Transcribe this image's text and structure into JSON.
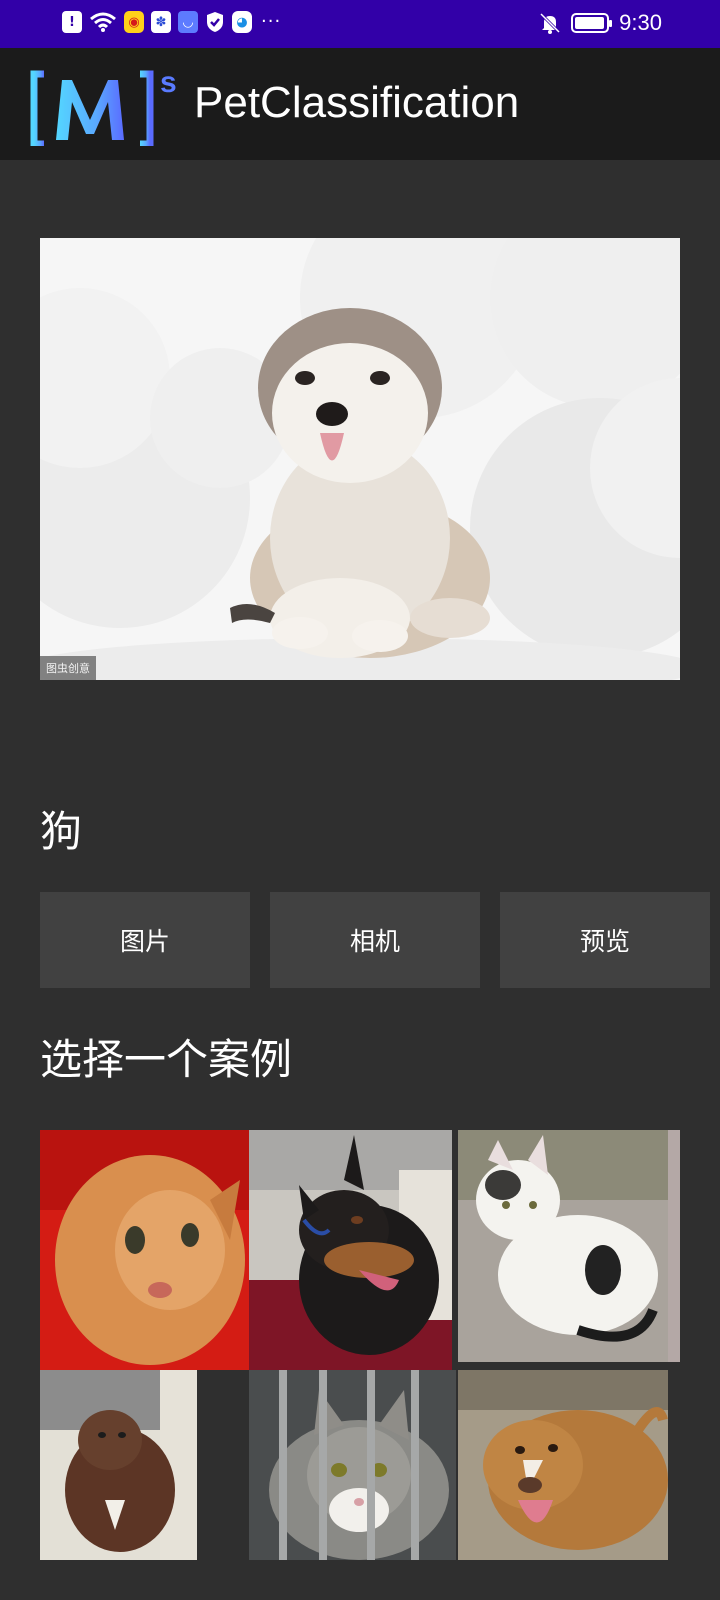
{
  "status_bar": {
    "time": "9:30",
    "more": "···",
    "left_icons": [
      "alert-icon",
      "wifi-icon",
      "weibo-icon",
      "baidu-icon",
      "app-icon",
      "shield-icon",
      "browser-icon"
    ],
    "right_icons": [
      "bell-off-icon",
      "battery-icon"
    ],
    "battery_level": 0.95
  },
  "app_bar": {
    "title": "PetClassification",
    "logo_text": "[M]s"
  },
  "hero": {
    "watermark": "图虫创意"
  },
  "result": {
    "label": "狗"
  },
  "buttons": {
    "image_label": "图片",
    "camera_label": "相机",
    "preview_label": "预览"
  },
  "examples": {
    "title": "选择一个案例",
    "items": [
      "orange-cat",
      "doberman-dog",
      "white-kitten",
      "brown-dog",
      "tabby-cat",
      "pitbull-dog"
    ]
  },
  "colors": {
    "status_bar": "#3200a8",
    "app_bar": "#1b1b1b",
    "background": "#2f2f2f",
    "button": "#414141"
  }
}
